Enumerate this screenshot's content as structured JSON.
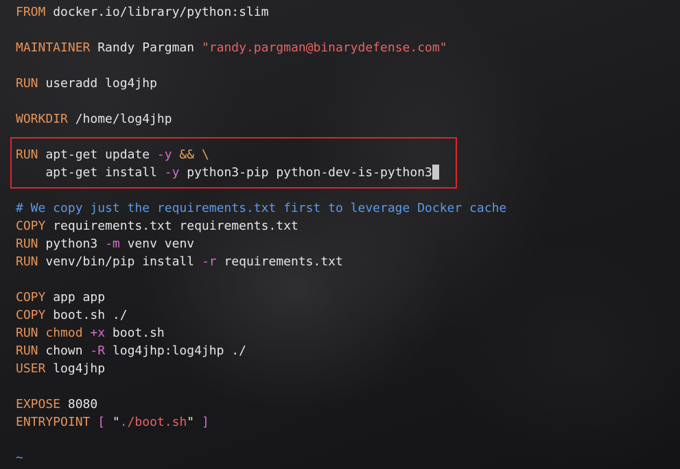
{
  "lines": {
    "l1": {
      "kw": "FROM",
      "rest": " docker.io/library/python:slim"
    },
    "l3": {
      "kw": "MAINTAINER",
      "text": " Randy Pargman ",
      "str": "\"randy.pargman@binarydefense.com\""
    },
    "l5": {
      "kw": "RUN",
      "rest": " useradd log4jhp"
    },
    "l7": {
      "kw": "WORKDIR",
      "rest": " /home/log4jhp"
    },
    "l9": {
      "kw": "RUN",
      "a": " apt-get update ",
      "flag": "-y",
      "op": " && \\"
    },
    "l10": {
      "a": "    apt-get install ",
      "flag": "-y",
      "b": " python3-pip python-dev-is-python3"
    },
    "l11": {
      "comment": "# We copy just the requirements.txt first to leverage Docker cache"
    },
    "l12": {
      "kw": "COPY",
      "rest": " requirements.txt requirements.txt"
    },
    "l13": {
      "kw": "RUN",
      "a": " python3 ",
      "flag": "-m",
      "b": " venv venv"
    },
    "l14": {
      "kw": "RUN",
      "a": " venv/bin/pip install ",
      "flag": "-r",
      "b": " requirements.txt"
    },
    "l16": {
      "kw": "COPY",
      "rest": " app app"
    },
    "l17": {
      "kw": "COPY",
      "rest": " boot.sh ./"
    },
    "l18": {
      "kw": "RUN",
      "a": " ",
      "cmd": "chmod",
      "flag": " +x",
      "b": " boot.sh"
    },
    "l19": {
      "kw": "RUN",
      "a": " chown ",
      "flag": "-R",
      "b": " log4jhp:log4jhp ./"
    },
    "l20": {
      "kw": "USER",
      "rest": " log4jhp"
    },
    "l22": {
      "kw": "EXPOSE",
      "rest": " 8080"
    },
    "l23": {
      "kw": "ENTRYPOINT",
      "sp": " ",
      "ob": "[",
      "s1": " \"",
      "str": "./boot.sh",
      "s2": "\" ",
      "cb": "]"
    },
    "l25": {
      "tilde": "~"
    }
  },
  "colors": {
    "instruction": "#e79459",
    "string": "#e76363",
    "flag": "#d76bd0",
    "comment": "#5b9ae8",
    "highlight_border": "#e0242a"
  }
}
